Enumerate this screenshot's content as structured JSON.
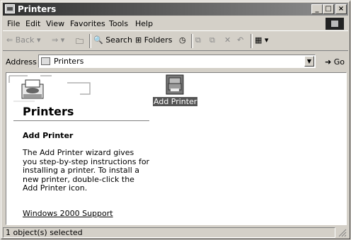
{
  "window": {
    "title": "Printers",
    "title_icon": "printer-folder-icon"
  },
  "title_buttons": {
    "minimize": "_",
    "maximize": "□",
    "close": "×"
  },
  "menu": [
    "File",
    "Edit",
    "View",
    "Favorites",
    "Tools",
    "Help"
  ],
  "toolbar": {
    "back": "Back",
    "search": "Search",
    "folders": "Folders",
    "history_icon": "history-icon",
    "move_to_icon": "move-to-icon",
    "copy_to_icon": "copy-to-icon",
    "delete_icon": "delete-icon",
    "undo_icon": "undo-icon",
    "views_icon": "views-icon"
  },
  "address": {
    "label": "Address",
    "value": "Printers",
    "go": "Go"
  },
  "left_pane": {
    "title": "Printers",
    "section_title": "Add Printer",
    "description": "The Add Printer wizard gives you step-by-step instructions for installing a printer. To install a new printer, double-click the Add Printer icon.",
    "support_link": "Windows 2000 Support"
  },
  "items": [
    {
      "label": "Add Printer",
      "icon": "add-printer-icon",
      "selected": true
    }
  ],
  "status": {
    "text": "1 object(s) selected"
  }
}
